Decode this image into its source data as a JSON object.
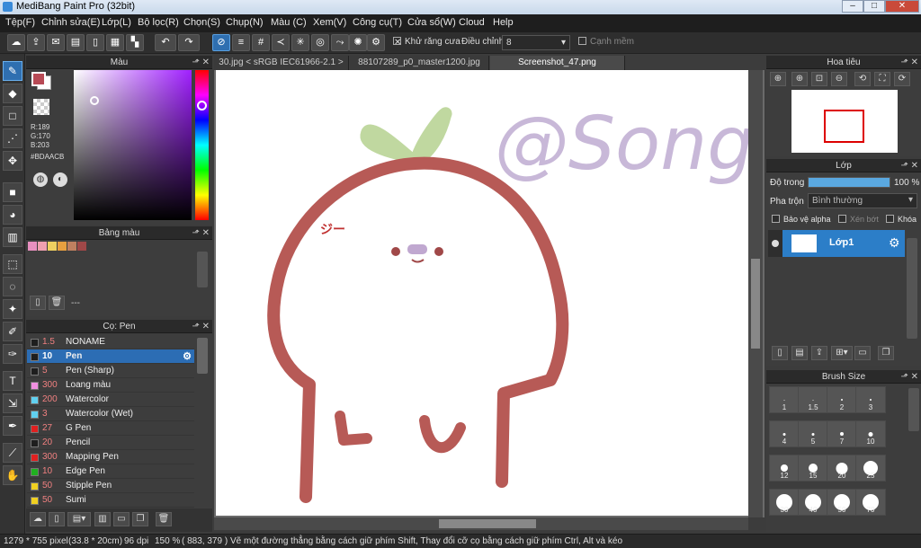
{
  "window": {
    "title": "MediBang Paint Pro (32bit)",
    "controls": [
      "–",
      "□",
      "✕"
    ]
  },
  "menu": [
    "Tệp(F)",
    "Chỉnh sửa(E)",
    "Lớp(L)",
    "Bộ lọc(R)",
    "Chọn(S)",
    "Chụp(N)",
    "Màu (C)",
    "Xem(V)",
    "Công cụ(T)",
    "Cửa sổ(W)",
    "Cloud",
    "Help"
  ],
  "toolbar": {
    "antialias_label": "Khử răng cưa",
    "adjust_label": "Điều chỉnh",
    "adjust_value": "8",
    "smooth_label": "Cạnh mềm"
  },
  "color_panel": {
    "title": "Màu",
    "r": "R:189",
    "g": "G:170",
    "b": "B:203",
    "hex": "#BDAACB",
    "primary_color": "#b84a55",
    "secondary_color": "#ffffff"
  },
  "palette_panel": {
    "title": "Bảng màu",
    "swatches": [
      "#e890c0",
      "#f0a0b0",
      "#f0d060",
      "#e8a040",
      "#c08060",
      "#a04848"
    ],
    "footer_text": "---"
  },
  "brush_panel": {
    "title": "Cọ: Pen",
    "items": [
      {
        "size": "1.5",
        "name": "NONAME",
        "color": "#1e1e1e",
        "selected": false
      },
      {
        "size": "10",
        "name": "Pen",
        "color": "#1e1e1e",
        "selected": true
      },
      {
        "size": "5",
        "name": "Pen (Sharp)",
        "color": "#1e1e1e",
        "selected": false
      },
      {
        "size": "300",
        "name": "Loang màu",
        "color": "#f090e0",
        "selected": false
      },
      {
        "size": "200",
        "name": "Watercolor",
        "color": "#60d0f0",
        "selected": false
      },
      {
        "size": "3",
        "name": "Watercolor (Wet)",
        "color": "#60d0f0",
        "selected": false
      },
      {
        "size": "27",
        "name": "G Pen",
        "color": "#e02020",
        "selected": false
      },
      {
        "size": "20",
        "name": "Pencil",
        "color": "#1e1e1e",
        "selected": false
      },
      {
        "size": "300",
        "name": "Mapping Pen",
        "color": "#e02020",
        "selected": false
      },
      {
        "size": "10",
        "name": "Edge Pen",
        "color": "#20b020",
        "selected": false
      },
      {
        "size": "50",
        "name": "Stipple Pen",
        "color": "#f0d020",
        "selected": false
      },
      {
        "size": "50",
        "name": "Sumi",
        "color": "#f0d020",
        "selected": false
      }
    ]
  },
  "tabs": [
    {
      "label": "30.jpg < sRGB IEC61966-2.1 >",
      "active": false
    },
    {
      "label": "88107289_p0_master1200.jpg",
      "active": false
    },
    {
      "label": "Screenshot_47.png",
      "active": true
    }
  ],
  "navigator_panel": {
    "title": "Hoa tiêu"
  },
  "layer_panel": {
    "title": "Lớp",
    "opacity_label": "Độ trong",
    "opacity_value": "100 %",
    "opacity_fraction": 1.0,
    "blend_label": "Pha trộn",
    "blend_value": "Bình thường",
    "protect_alpha": "Bảo vệ alpha",
    "clip": "Xén bớt",
    "lock": "Khóa",
    "layers": [
      {
        "name": "Lớp1"
      }
    ]
  },
  "brush_size_panel": {
    "title": "Brush Size",
    "sizes": [
      "1",
      "1.5",
      "2",
      "3",
      "4",
      "5",
      "7",
      "10",
      "12",
      "15",
      "20",
      "25",
      "30",
      "40",
      "50",
      "70"
    ]
  },
  "canvas": {
    "watermark_text": "@Song",
    "anger_mark": "ジー"
  },
  "status": {
    "size": "1279 * 755 pixel",
    "dimensions": "(33.8 * 20cm)",
    "dpi": "96 dpi",
    "zoom": "150 %",
    "coords": "( 883, 379 )",
    "hint": "Vẽ một đường thẳng bằng cách giữ phím Shift, Thay đổi cỡ cọ bằng cách giữ phím Ctrl, Alt và kéo"
  }
}
